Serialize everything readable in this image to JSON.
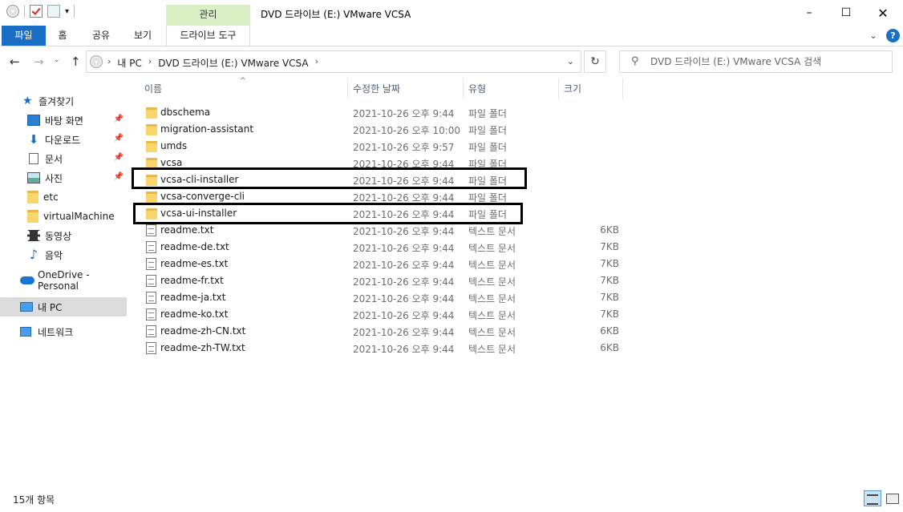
{
  "window": {
    "title": "DVD 드라이브 (E:) VMware VCSA",
    "manage_tab": "관리",
    "controls": {
      "minimize": "–",
      "maximize": "☐",
      "close": "✕"
    }
  },
  "ribbon": {
    "tabs": [
      {
        "id": "file",
        "label": "파일"
      },
      {
        "id": "home",
        "label": "홈"
      },
      {
        "id": "share",
        "label": "공유"
      },
      {
        "id": "view",
        "label": "보기"
      },
      {
        "id": "drive",
        "label": "드라이브 도구"
      }
    ],
    "help": "?",
    "accent": "#1a6fc4",
    "manage_color": "#dbefc5"
  },
  "address": {
    "breadcrumbs": [
      "내 PC",
      "DVD 드라이브 (E:) VMware VCSA"
    ],
    "search_placeholder": "DVD 드라이브 (E:) VMware VCSA 검색"
  },
  "sidebar": {
    "items": [
      {
        "label": "즐겨찾기",
        "icon": "star-icon",
        "pinned": false
      },
      {
        "label": "바탕 화면",
        "icon": "desktop-icon",
        "pinned": true
      },
      {
        "label": "다운로드",
        "icon": "download-icon",
        "pinned": true
      },
      {
        "label": "문서",
        "icon": "document-icon",
        "pinned": true
      },
      {
        "label": "사진",
        "icon": "pictures-icon",
        "pinned": true
      },
      {
        "label": "etc",
        "icon": "folder-icon",
        "pinned": false
      },
      {
        "label": "virtualMachine",
        "icon": "folder-icon",
        "pinned": false
      },
      {
        "label": "동영상",
        "icon": "video-icon",
        "pinned": false
      },
      {
        "label": "음악",
        "icon": "music-icon",
        "pinned": false
      },
      {
        "label": "OneDrive - Personal",
        "icon": "onedrive-icon",
        "pinned": false
      },
      {
        "label": "내 PC",
        "icon": "pc-icon",
        "pinned": false,
        "selected": true
      },
      {
        "label": "네트워크",
        "icon": "network-icon",
        "pinned": false
      }
    ]
  },
  "columns": {
    "name": "이름",
    "date": "수정한 날짜",
    "type": "유형",
    "size": "크기"
  },
  "files": [
    {
      "name": "dbschema",
      "date": "2021-10-26 오후 9:44",
      "type": "파일 폴더",
      "size": "",
      "kind": "folder"
    },
    {
      "name": "migration-assistant",
      "date": "2021-10-26 오후 10:00",
      "type": "파일 폴더",
      "size": "",
      "kind": "folder"
    },
    {
      "name": "umds",
      "date": "2021-10-26 오후 9:57",
      "type": "파일 폴더",
      "size": "",
      "kind": "folder"
    },
    {
      "name": "vcsa",
      "date": "2021-10-26 오후 9:44",
      "type": "파일 폴더",
      "size": "",
      "kind": "folder"
    },
    {
      "name": "vcsa-cli-installer",
      "date": "2021-10-26 오후 9:44",
      "type": "파일 폴더",
      "size": "",
      "kind": "folder",
      "highlighted": true
    },
    {
      "name": "vcsa-converge-cli",
      "date": "2021-10-26 오후 9:44",
      "type": "파일 폴더",
      "size": "",
      "kind": "folder"
    },
    {
      "name": "vcsa-ui-installer",
      "date": "2021-10-26 오후 9:44",
      "type": "파일 폴더",
      "size": "",
      "kind": "folder",
      "highlighted": true
    },
    {
      "name": "readme.txt",
      "date": "2021-10-26 오후 9:44",
      "type": "텍스트 문서",
      "size": "6KB",
      "kind": "file"
    },
    {
      "name": "readme-de.txt",
      "date": "2021-10-26 오후 9:44",
      "type": "텍스트 문서",
      "size": "7KB",
      "kind": "file"
    },
    {
      "name": "readme-es.txt",
      "date": "2021-10-26 오후 9:44",
      "type": "텍스트 문서",
      "size": "7KB",
      "kind": "file"
    },
    {
      "name": "readme-fr.txt",
      "date": "2021-10-26 오후 9:44",
      "type": "텍스트 문서",
      "size": "7KB",
      "kind": "file"
    },
    {
      "name": "readme-ja.txt",
      "date": "2021-10-26 오후 9:44",
      "type": "텍스트 문서",
      "size": "7KB",
      "kind": "file"
    },
    {
      "name": "readme-ko.txt",
      "date": "2021-10-26 오후 9:44",
      "type": "텍스트 문서",
      "size": "7KB",
      "kind": "file"
    },
    {
      "name": "readme-zh-CN.txt",
      "date": "2021-10-26 오후 9:44",
      "type": "텍스트 문서",
      "size": "6KB",
      "kind": "file"
    },
    {
      "name": "readme-zh-TW.txt",
      "date": "2021-10-26 오후 9:44",
      "type": "텍스트 문서",
      "size": "6KB",
      "kind": "file"
    }
  ],
  "status": {
    "count": "15개 항목"
  }
}
